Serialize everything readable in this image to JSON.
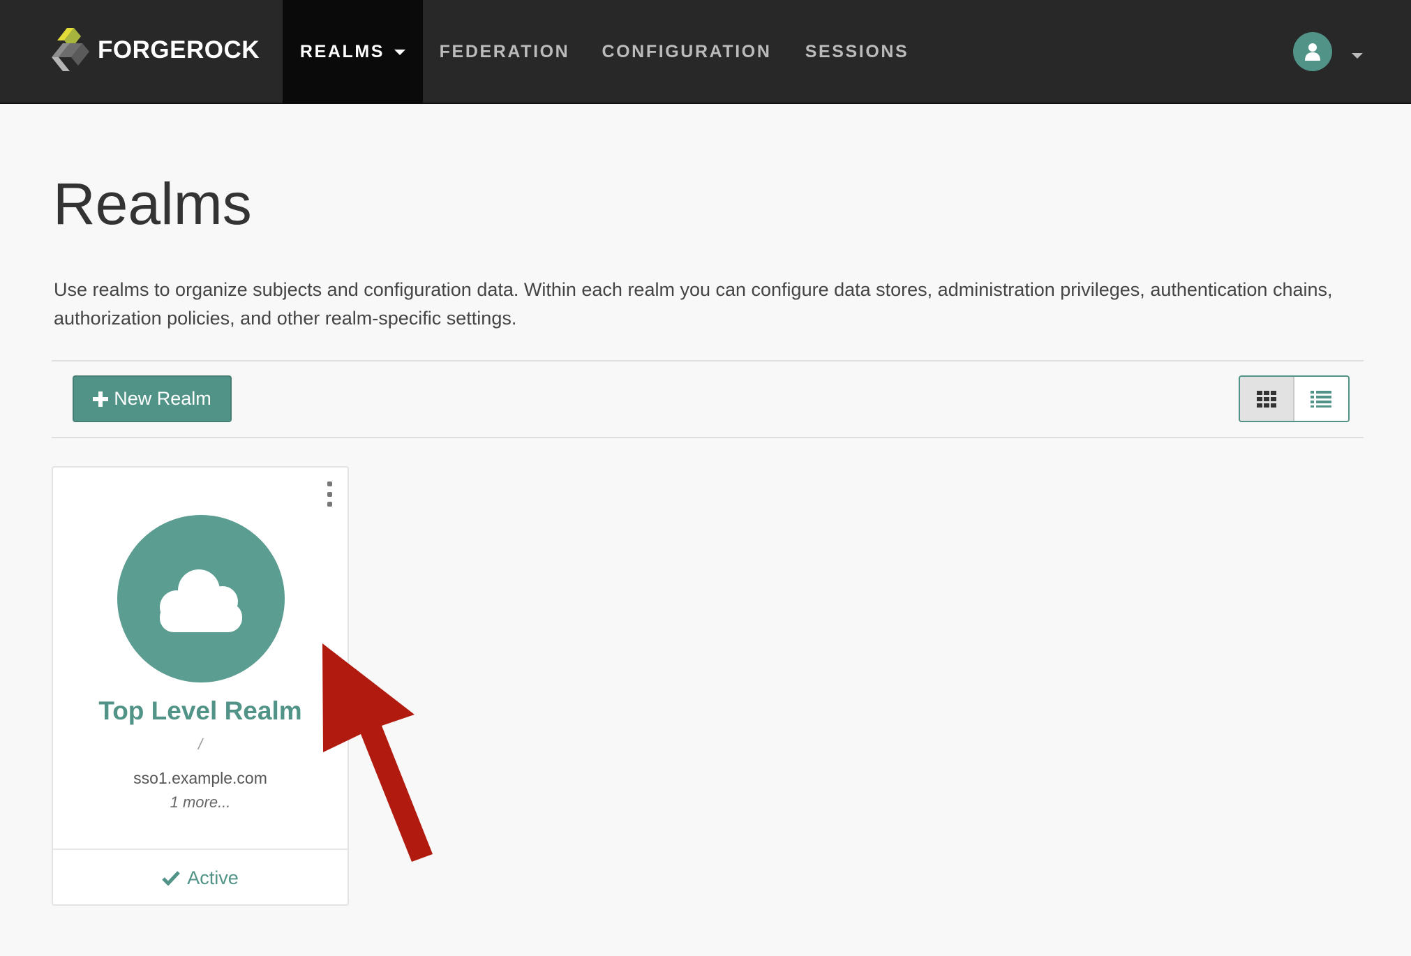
{
  "brand": {
    "name": "FORGEROCK"
  },
  "nav": {
    "items": [
      {
        "label": "REALMS",
        "active": true,
        "has_caret": true
      },
      {
        "label": "FEDERATION"
      },
      {
        "label": "CONFIGURATION"
      },
      {
        "label": "SESSIONS"
      }
    ],
    "user_icon": "user-icon"
  },
  "page": {
    "title": "Realms",
    "intro": "Use realms to organize subjects and configuration data. Within each realm you can configure data stores, administration privileges, authentication chains, authorization policies, and other realm-specific settings."
  },
  "toolbar": {
    "new_button_label": "New Realm",
    "view_modes": [
      "grid",
      "list"
    ],
    "active_view": "list"
  },
  "realms": [
    {
      "name": "Top Level Realm",
      "path": "/",
      "host": "sso1.example.com",
      "more": "1 more...",
      "status": "Active",
      "icon": "cloud-icon"
    }
  ],
  "colors": {
    "accent": "#519387",
    "navbar": "#282828",
    "arrow": "#b11a0e"
  }
}
